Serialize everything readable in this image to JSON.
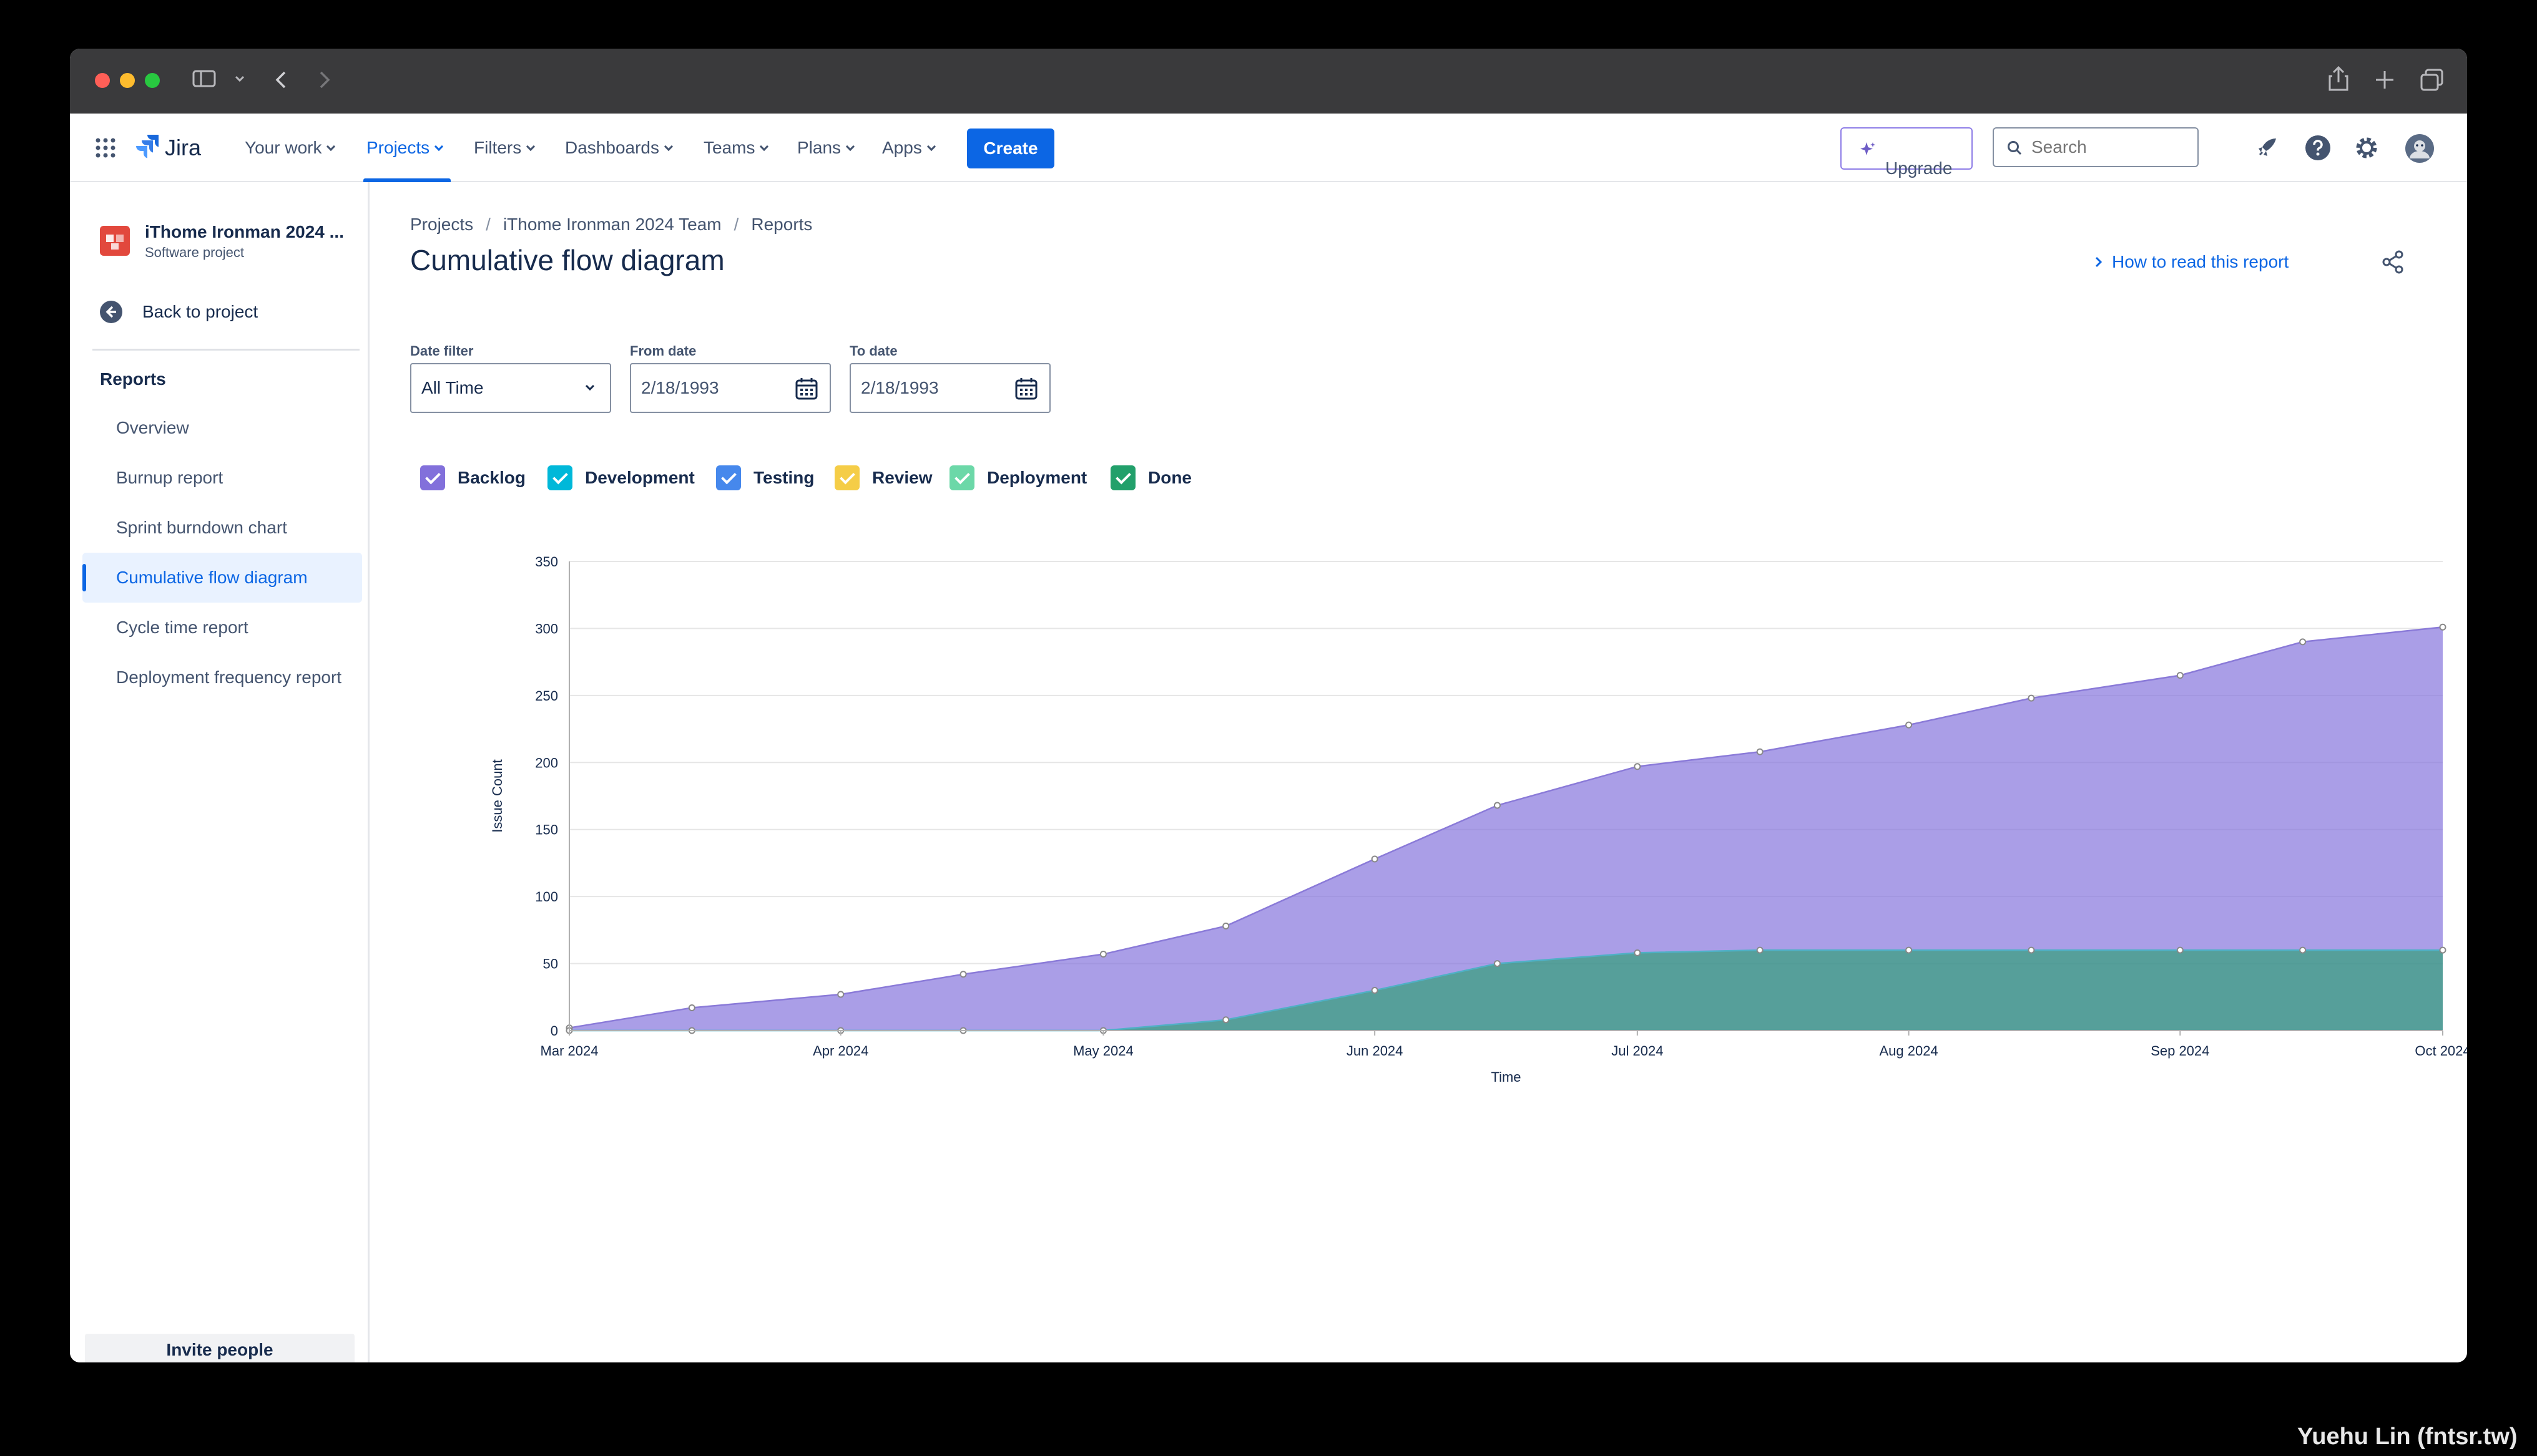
{
  "nav": {
    "brand": "Jira",
    "items": [
      {
        "label": "Your work"
      },
      {
        "label": "Projects"
      },
      {
        "label": "Filters"
      },
      {
        "label": "Dashboards"
      },
      {
        "label": "Teams"
      },
      {
        "label": "Plans"
      },
      {
        "label": "Apps"
      }
    ],
    "active_item": "Projects",
    "create_label": "Create",
    "upgrade_label": "Upgrade",
    "search_placeholder": "Search"
  },
  "sidebar": {
    "project_name": "iThome Ironman 2024 ...",
    "project_type": "Software project",
    "back_label": "Back to project",
    "heading": "Reports",
    "items": [
      {
        "label": "Overview"
      },
      {
        "label": "Burnup report"
      },
      {
        "label": "Sprint burndown chart"
      },
      {
        "label": "Cumulative flow diagram"
      },
      {
        "label": "Cycle time report"
      },
      {
        "label": "Deployment frequency report"
      }
    ],
    "active_item": "Cumulative flow diagram",
    "invite_label": "Invite people"
  },
  "page": {
    "breadcrumbs": [
      "Projects",
      "iThome Ironman 2024 Team",
      "Reports"
    ],
    "title": "Cumulative flow diagram",
    "how_to_label": "How to read this report"
  },
  "filters": {
    "date_filter_label": "Date filter",
    "date_filter_value": "All Time",
    "from_label": "From date",
    "from_value": "2/18/1993",
    "to_label": "To date",
    "to_value": "2/18/1993"
  },
  "legend": [
    {
      "label": "Backlog",
      "color": "#8270db"
    },
    {
      "label": "Development",
      "color": "#1d9aaa"
    },
    {
      "label": "Testing",
      "color": "#4688ec"
    },
    {
      "label": "Review",
      "color": "#f5cd47"
    },
    {
      "label": "Deployment",
      "color": "#4bce97"
    },
    {
      "label": "Done",
      "color": "#22a06b"
    }
  ],
  "chart_data": {
    "type": "area",
    "xlabel": "Time",
    "ylabel": "Issue Count",
    "ylim": [
      0,
      350
    ],
    "yticks": [
      0,
      50,
      100,
      150,
      200,
      250,
      300,
      350
    ],
    "xticks": [
      "Mar 2024",
      "Apr 2024",
      "May 2024",
      "Jun 2024",
      "Jul 2024",
      "Aug 2024",
      "Sep 2024",
      "Oct 2024"
    ],
    "x": [
      "2024-03-01",
      "2024-03-15",
      "2024-04-01",
      "2024-04-15",
      "2024-05-01",
      "2024-05-15",
      "2024-06-01",
      "2024-06-15",
      "2024-07-01",
      "2024-07-15",
      "2024-08-01",
      "2024-08-15",
      "2024-09-01",
      "2024-09-15",
      "2024-10-01"
    ],
    "series": [
      {
        "name": "Backlog",
        "color": "#8270db",
        "values": [
          2,
          17,
          27,
          42,
          57,
          78,
          128,
          168,
          197,
          208,
          228,
          248,
          265,
          290,
          301
        ]
      },
      {
        "name": "Done",
        "color": "#22a06b",
        "values": [
          0,
          0,
          0,
          0,
          0,
          8,
          30,
          50,
          58,
          60,
          60,
          60,
          60,
          60,
          60
        ]
      }
    ],
    "legend_position": "top-left",
    "grid": true
  }
}
